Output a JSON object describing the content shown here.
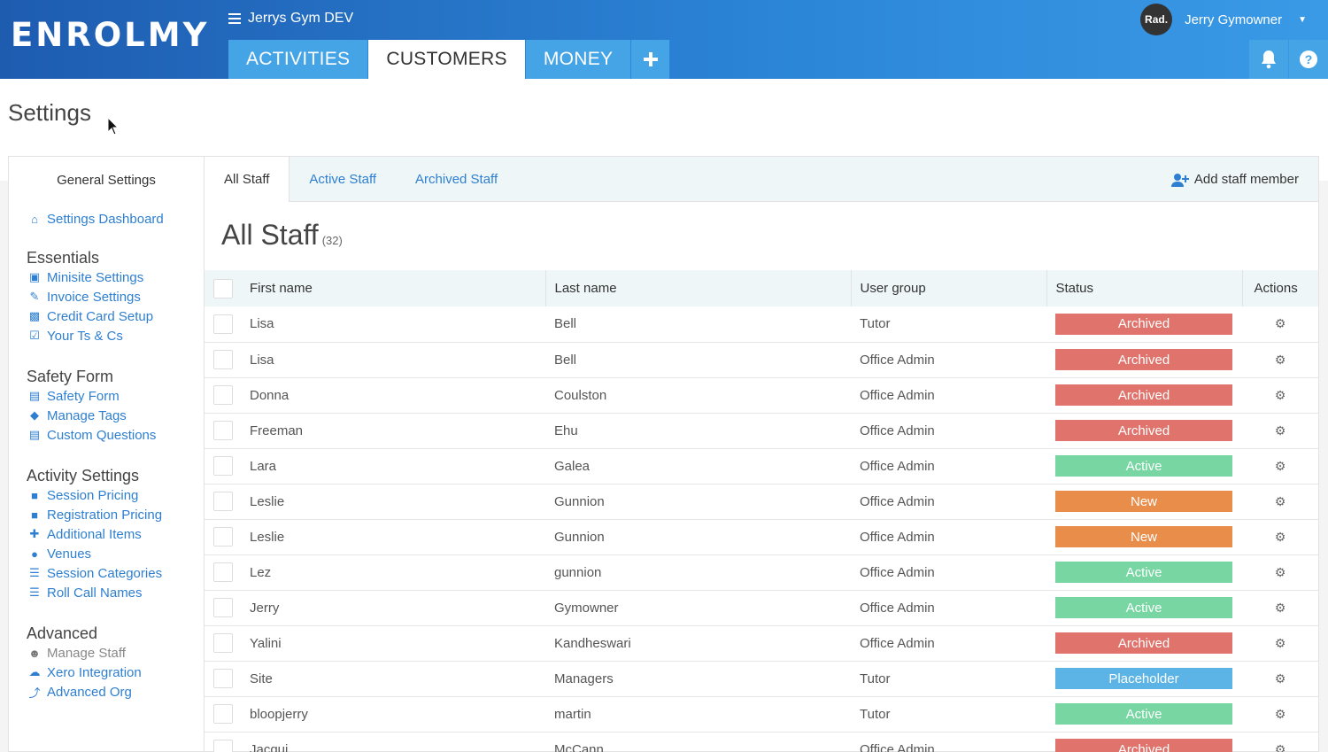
{
  "header": {
    "logo": "ENROLMY",
    "org_name": "Jerrys Gym DEV",
    "tabs": [
      {
        "label": "ACTIVITIES",
        "active": false
      },
      {
        "label": "CUSTOMERS",
        "active": true
      },
      {
        "label": "MONEY",
        "active": false
      }
    ],
    "plus_label": "+",
    "user": {
      "avatar_text": "Rad.",
      "name": "Jerry Gymowner"
    },
    "help_label": "?"
  },
  "page": {
    "title": "Settings"
  },
  "sidebar": {
    "heading": "General Settings",
    "dashboard": {
      "label": "Settings Dashboard",
      "icon": "home-icon"
    },
    "sections": [
      {
        "title": "Essentials",
        "items": [
          {
            "label": "Minisite Settings",
            "icon": "cube-icon"
          },
          {
            "label": "Invoice Settings",
            "icon": "pencil-icon"
          },
          {
            "label": "Credit Card Setup",
            "icon": "money-icon"
          },
          {
            "label": "Your Ts & Cs",
            "icon": "check-square-icon"
          }
        ]
      },
      {
        "title": "Safety Form",
        "items": [
          {
            "label": "Safety Form",
            "icon": "file-icon"
          },
          {
            "label": "Manage Tags",
            "icon": "tags-icon"
          },
          {
            "label": "Custom Questions",
            "icon": "file-icon"
          }
        ]
      },
      {
        "title": "Activity Settings",
        "items": [
          {
            "label": "Session Pricing",
            "icon": "briefcase-icon"
          },
          {
            "label": "Registration Pricing",
            "icon": "briefcase-icon"
          },
          {
            "label": "Additional Items",
            "icon": "puzzle-icon"
          },
          {
            "label": "Venues",
            "icon": "map-marker-icon"
          },
          {
            "label": "Session Categories",
            "icon": "list-icon"
          },
          {
            "label": "Roll Call Names",
            "icon": "list-icon"
          }
        ]
      },
      {
        "title": "Advanced",
        "items": [
          {
            "label": "Manage Staff",
            "icon": "users-icon",
            "current": true
          },
          {
            "label": "Xero Integration",
            "icon": "cloud-icon"
          },
          {
            "label": "Advanced Org",
            "icon": "bolt-icon"
          }
        ]
      }
    ]
  },
  "staff": {
    "tabs": [
      {
        "label": "All Staff",
        "active": true
      },
      {
        "label": "Active Staff",
        "active": false
      },
      {
        "label": "Archived Staff",
        "active": false
      }
    ],
    "add_label": "Add staff member",
    "title": "All Staff",
    "count": "(32)",
    "columns": [
      "First name",
      "Last name",
      "User group",
      "Status",
      "Actions"
    ],
    "rows": [
      {
        "first": "Lisa",
        "last": "Bell",
        "group": "Tutor",
        "status": "Archived"
      },
      {
        "first": "Lisa",
        "last": "Bell",
        "group": "Office Admin",
        "status": "Archived"
      },
      {
        "first": "Donna",
        "last": "Coulston",
        "group": "Office Admin",
        "status": "Archived"
      },
      {
        "first": "Freeman",
        "last": "Ehu",
        "group": "Office Admin",
        "status": "Archived"
      },
      {
        "first": "Lara",
        "last": "Galea",
        "group": "Office Admin",
        "status": "Active"
      },
      {
        "first": "Leslie",
        "last": "Gunnion",
        "group": "Office Admin",
        "status": "New"
      },
      {
        "first": "Leslie",
        "last": "Gunnion",
        "group": "Office Admin",
        "status": "New"
      },
      {
        "first": "Lez",
        "last": "gunnion",
        "group": "Office Admin",
        "status": "Active"
      },
      {
        "first": "Jerry",
        "last": "Gymowner",
        "group": "Office Admin",
        "status": "Active"
      },
      {
        "first": "Yalini",
        "last": "Kandheswari",
        "group": "Office Admin",
        "status": "Archived"
      },
      {
        "first": "Site",
        "last": "Managers",
        "group": "Tutor",
        "status": "Placeholder"
      },
      {
        "first": "bloopjerry",
        "last": "martin",
        "group": "Tutor",
        "status": "Active"
      },
      {
        "first": "Jacqui",
        "last": "McCann",
        "group": "Office Admin",
        "status": "Archived"
      }
    ]
  },
  "colors": {
    "header_gradient_start": "#1e5cb0",
    "header_gradient_end": "#3a9ae6",
    "link": "#2e7fd0",
    "archived": "#e0736b",
    "active": "#78d6a3",
    "new": "#e98d4b",
    "placeholder": "#5bb4e5"
  }
}
